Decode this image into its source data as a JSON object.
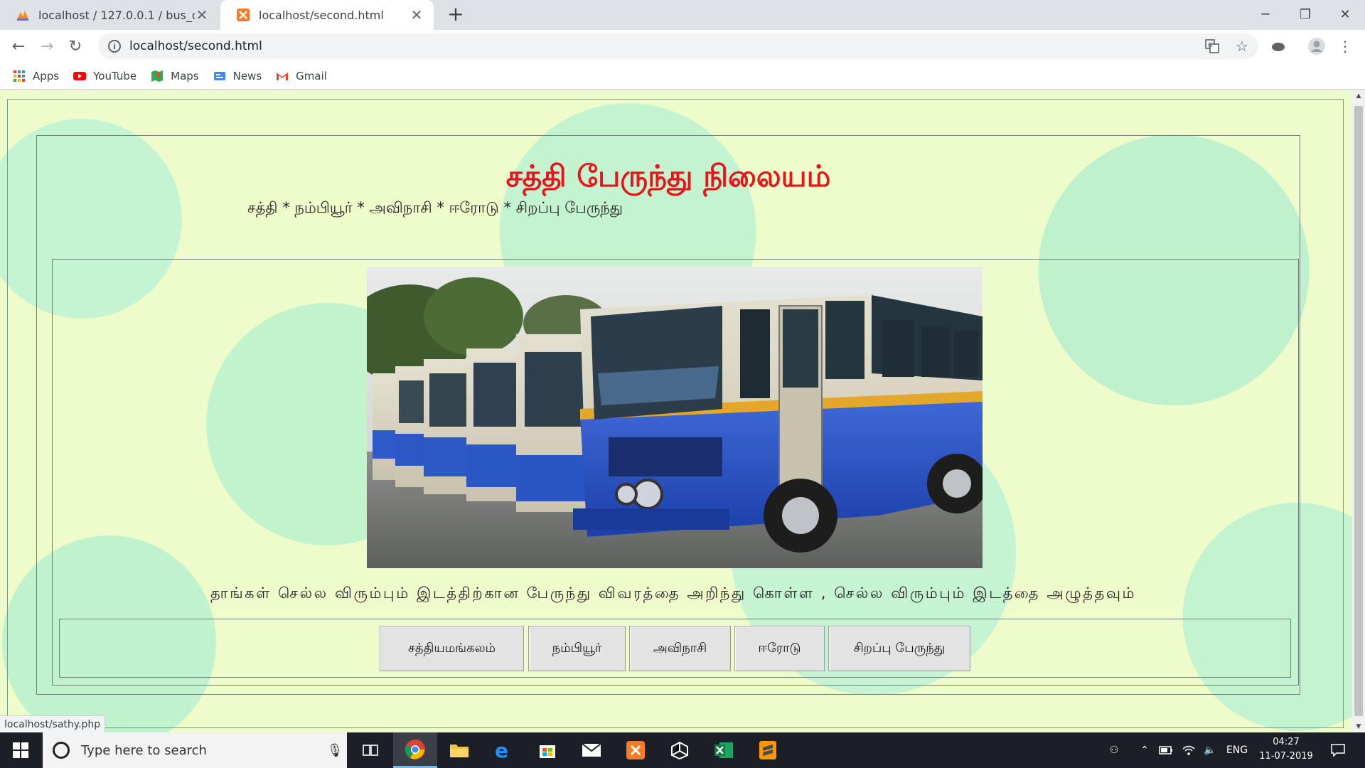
{
  "browser": {
    "tabs": [
      {
        "title": "localhost / 127.0.0.1 / bus_details",
        "active": false
      },
      {
        "title": "localhost/second.html",
        "active": true
      }
    ],
    "url": "localhost/second.html",
    "bookmarks": [
      {
        "label": "Apps",
        "icon": "apps-grid-icon"
      },
      {
        "label": "YouTube",
        "icon": "youtube-icon"
      },
      {
        "label": "Maps",
        "icon": "maps-icon"
      },
      {
        "label": "News",
        "icon": "news-icon"
      },
      {
        "label": "Gmail",
        "icon": "gmail-icon"
      }
    ],
    "status_url": "localhost/sathy.php"
  },
  "page": {
    "heading": "சத்தி பேருந்து நிலையம்",
    "route_line": "சத்தி * நம்பியூர் * அவிநாசி * ஈரோடு * சிறப்பு பேருந்து",
    "image_alt": "bus-photo",
    "instruction": "தாங்கள் செல்ல விரும்பும் இடத்திற்கான பேருந்து விவரத்தை அறிந்து கொள்ள , செல்ல விரும்பும் இடத்தை அழுத்தவும்",
    "buttons": [
      "சத்தியமங்கலம்",
      "நம்பியூர்",
      "அவிநாசி",
      "ஈரோடு",
      "சிறப்பு பேருந்து"
    ],
    "heading_color": "#e8141a"
  },
  "taskbar": {
    "search_placeholder": "Type here to search",
    "language": "ENG",
    "time": "04:27",
    "date": "11-07-2019"
  }
}
